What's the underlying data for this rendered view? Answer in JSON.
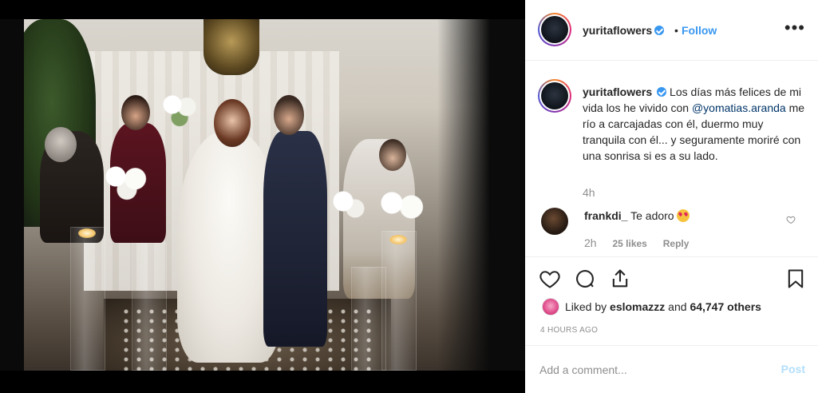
{
  "post": {
    "author": "yuritaflowers",
    "separator": "•",
    "follow_label": "Follow",
    "more_label": "•••",
    "verified": true
  },
  "caption": {
    "username": "yuritaflowers",
    "text_before": "Los días más felices de mi vida los he vivido con ",
    "mention": "@yomatias.aranda",
    "text_after": " me río a carcajadas con él, duermo muy tranquila con él... y seguramente moriré con una sonrisa si es a su lado.",
    "time": "4h"
  },
  "comment": {
    "username": "frankdi_",
    "text": "Te adoro",
    "emoji": "heart-eyes-emoji",
    "time": "2h",
    "likes": "25 likes",
    "reply": "Reply"
  },
  "actions": {
    "icons": [
      "heart-icon",
      "comment-icon",
      "share-icon",
      "bookmark-icon"
    ]
  },
  "likes": {
    "prefix": "Liked by ",
    "user": "eslomazzz",
    "middle": " and ",
    "count": "64,747 others"
  },
  "timestamp": "4 HOURS AGO",
  "add_comment": {
    "placeholder": "Add a comment...",
    "post_label": "Post"
  },
  "colors": {
    "accent": "#3897f0",
    "mention": "#003569",
    "muted": "#8e8e8e",
    "post_disabled": "#b2dffc"
  }
}
